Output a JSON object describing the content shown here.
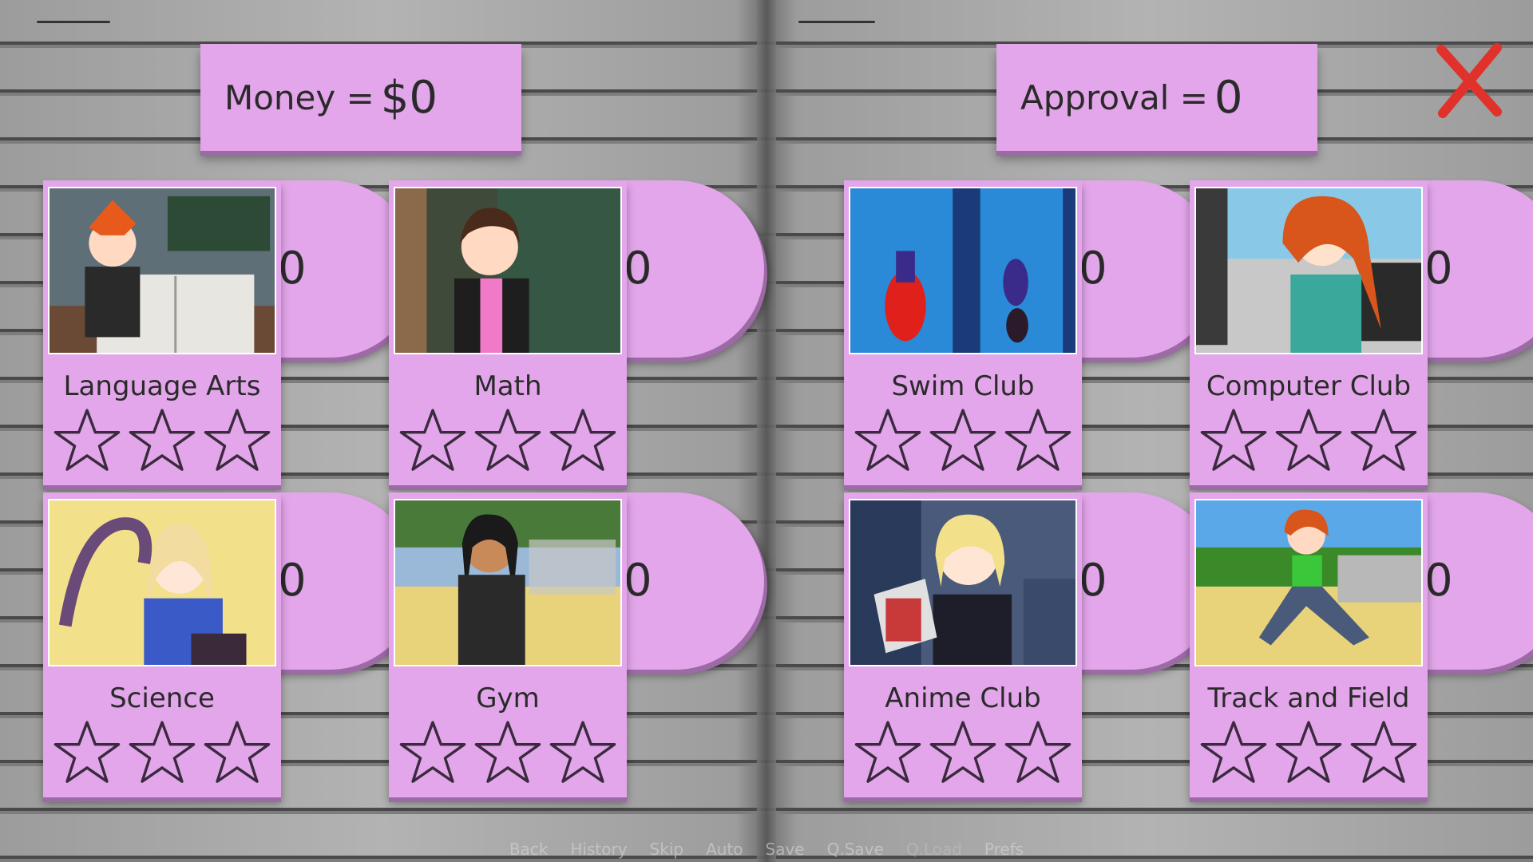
{
  "money": {
    "label": "Money =",
    "value": "$0"
  },
  "approval": {
    "label": "Approval =",
    "value": "0"
  },
  "close": {
    "icon": "close-icon",
    "color": "#e0322a"
  },
  "colors": {
    "panel": "#e3a6ea",
    "panel_shadow": "#9c6aa4",
    "close": "#e0322a"
  },
  "subjects": [
    {
      "title": "Language Arts",
      "level": "0",
      "stars_filled": 0,
      "stars_total": 3
    },
    {
      "title": "Math",
      "level": "0",
      "stars_filled": 0,
      "stars_total": 3
    },
    {
      "title": "Science",
      "level": "0",
      "stars_filled": 0,
      "stars_total": 3
    },
    {
      "title": "Gym",
      "level": "0",
      "stars_filled": 0,
      "stars_total": 3
    }
  ],
  "clubs": [
    {
      "title": "Swim Club",
      "level": "0",
      "stars_filled": 0,
      "stars_total": 3
    },
    {
      "title": "Computer Club",
      "level": "0",
      "stars_filled": 0,
      "stars_total": 3
    },
    {
      "title": "Anime Club",
      "level": "0",
      "stars_filled": 0,
      "stars_total": 3
    },
    {
      "title": "Track and Field",
      "level": "0",
      "stars_filled": 0,
      "stars_total": 3
    }
  ],
  "quick_menu": [
    "Back",
    "History",
    "Skip",
    "Auto",
    "Save",
    "Q.Save",
    "Q.Load",
    "Prefs"
  ]
}
